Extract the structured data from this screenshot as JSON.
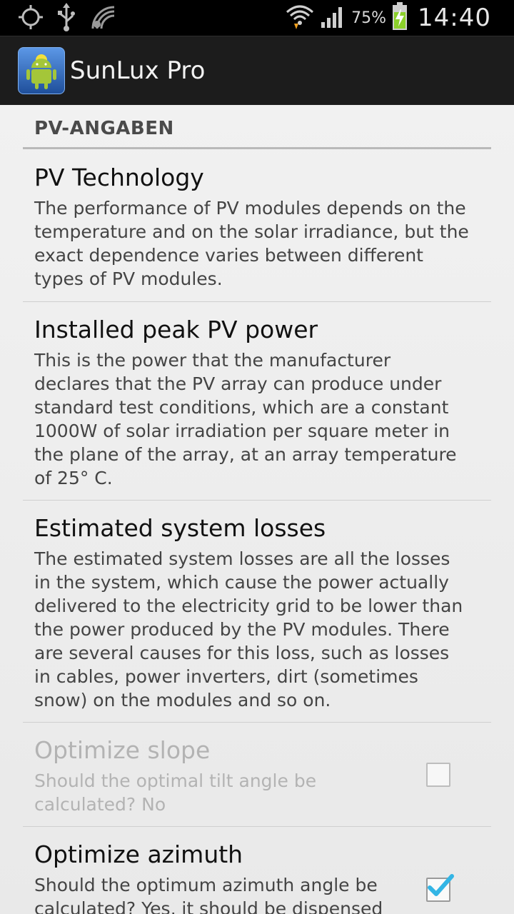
{
  "status_bar": {
    "left_icons": [
      "gps-icon",
      "usb-icon",
      "nfc-icon"
    ],
    "right_icons": [
      "wifi-icon",
      "signal-icon",
      "battery-icon"
    ],
    "battery_percent": "75%",
    "time": "14:40"
  },
  "action_bar": {
    "title": "SunLux Pro"
  },
  "section": {
    "header": "PV-ANGABEN"
  },
  "prefs": [
    {
      "title": "PV Technology",
      "summary": "The performance of PV modules depends on the temperature and on the solar irradiance, but the exact dependence varies between different types of PV modules."
    },
    {
      "title": "Installed peak PV power",
      "summary": "This is the power that the manufacturer declares that the PV array can produce under standard test conditions, which are a constant 1000W of solar irradiation per square meter in the plane of the array, at an array temperature of 25° C."
    },
    {
      "title": "Estimated system losses",
      "summary": "The estimated system losses are all the losses in the system, which cause the power actually delivered to the electricity grid to be lower than the power produced by the PV modules. There are several causes for this loss, such as losses in cables, power inverters, dirt (sometimes snow) on the modules and so on."
    },
    {
      "title": "Optimize slope",
      "summary": "Should the optimal tilt angle be calculated? No",
      "checked": false,
      "enabled": false
    },
    {
      "title": "Optimize azimuth",
      "summary": "Should the optimum azimuth angle be calculated? Yes, it should be dispensed",
      "checked": true,
      "enabled": true
    }
  ],
  "colors": {
    "check_accent": "#33b5e5",
    "action_bar_bg": "#1c1c1c",
    "status_bar_bg": "#000000"
  }
}
